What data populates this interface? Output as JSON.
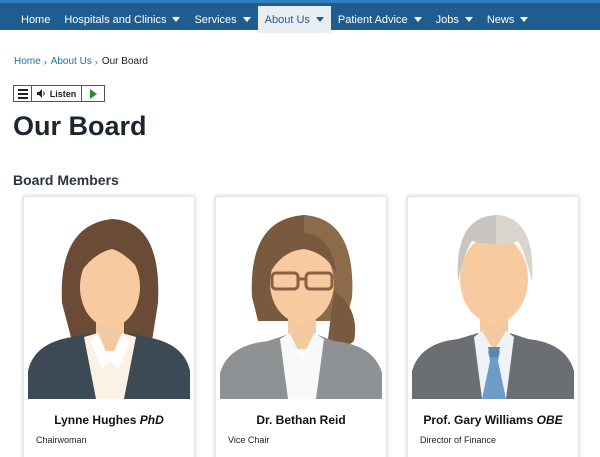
{
  "nav": {
    "items": [
      {
        "label": "Home",
        "dropdown": false,
        "active": false
      },
      {
        "label": "Hospitals and Clinics",
        "dropdown": true,
        "active": false
      },
      {
        "label": "Services",
        "dropdown": true,
        "active": false
      },
      {
        "label": "About Us",
        "dropdown": true,
        "active": true
      },
      {
        "label": "Patient Advice",
        "dropdown": true,
        "active": false
      },
      {
        "label": "Jobs",
        "dropdown": true,
        "active": false
      },
      {
        "label": "News",
        "dropdown": true,
        "active": false
      }
    ]
  },
  "breadcrumb": {
    "items": [
      "Home",
      "About Us"
    ],
    "current": "Our Board"
  },
  "listen": {
    "label": "Listen",
    "menu_icon": "menu-icon",
    "speaker_icon": "speaker-icon",
    "play_icon": "play-icon"
  },
  "page": {
    "title": "Our Board",
    "section": "Board Members"
  },
  "board": [
    {
      "name": "Lynne Hughes",
      "suffix": "PhD",
      "role": "Chairwoman"
    },
    {
      "name": "Dr. Bethan Reid",
      "suffix": "",
      "role": "Vice Chair"
    },
    {
      "name": "Prof. Gary Williams",
      "suffix": "OBE",
      "role": "Director of Finance"
    }
  ],
  "colors": {
    "nav_bg": "#1f5c8f",
    "nav_active_bg": "#e9eef3",
    "link": "#1f6fa6",
    "play": "#2e8b2e"
  }
}
